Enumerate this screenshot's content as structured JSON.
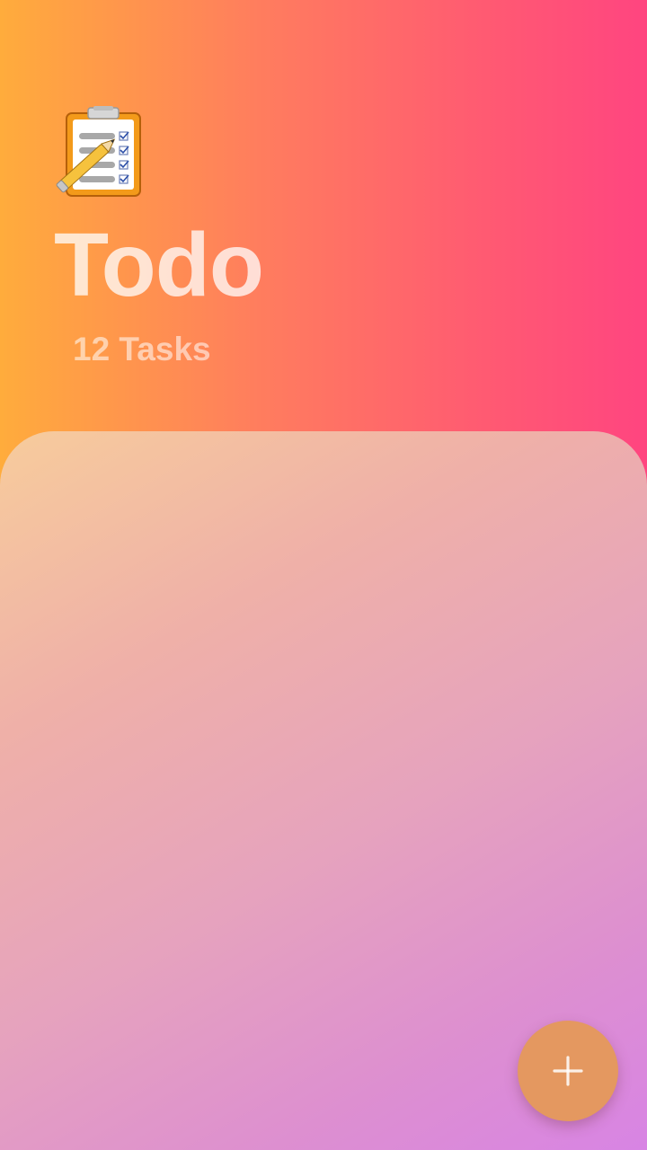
{
  "header": {
    "app_icon": "clipboard-checklist-icon",
    "title": "Todo",
    "task_count": "12 Tasks"
  },
  "task_list": {
    "items": []
  },
  "fab": {
    "icon": "plus-icon"
  },
  "colors": {
    "gradient_start": "#ffac3c",
    "gradient_end": "#ff4580",
    "panel_start": "#f7cc9c",
    "panel_end": "#d884e4",
    "fab": "#e49860"
  }
}
